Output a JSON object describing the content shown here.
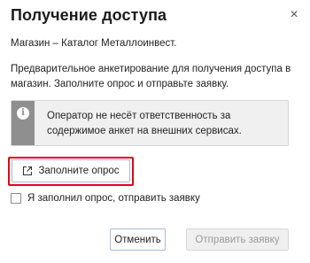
{
  "dialog": {
    "title": "Получение доступа",
    "close_symbol": "×",
    "store_line": "Магазин – Каталог Металлоинвест.",
    "intro_text": "Предварительное анкетирование для получения доступа в магазин. Заполните опрос и отправьте заявку.",
    "notice": {
      "icon": "info-icon",
      "icon_glyph": "i",
      "text": "Оператор не несёт ответственность за содержимое анкет на внешних сервисах."
    },
    "fill_button_label": "Заполните опрос",
    "checkbox_label": "Я заполнил опрос, отправить заявку",
    "checkbox_checked": false,
    "cancel_label": "Отменить",
    "send_label": "Отправить заявку",
    "send_enabled": false
  },
  "colors": {
    "highlight": "#e3001b",
    "notice_bar": "#8f8f8f",
    "button_border": "#a9bcd6"
  }
}
